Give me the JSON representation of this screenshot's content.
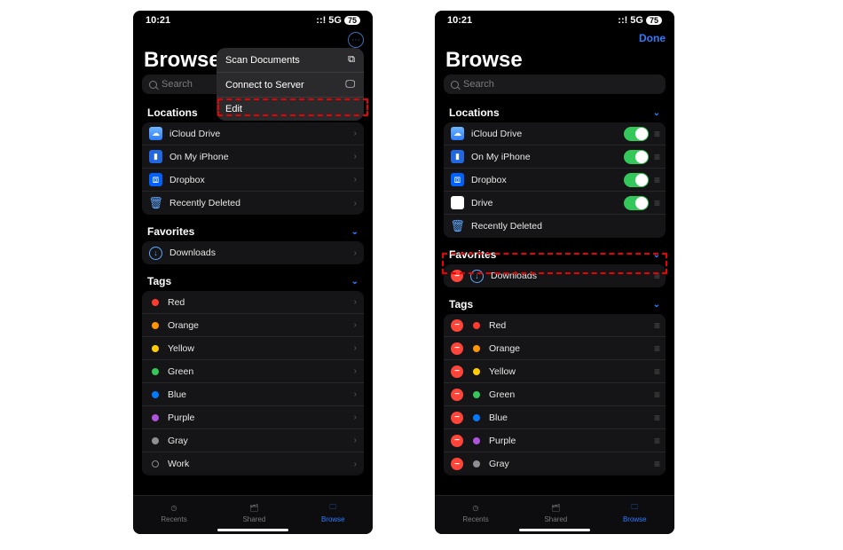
{
  "status": {
    "time": "10:21",
    "network": "5G",
    "battery": "75"
  },
  "left": {
    "title": "Browse",
    "search_placeholder": "Search",
    "popup": {
      "scan": "Scan Documents",
      "connect": "Connect to Server",
      "edit": "Edit"
    },
    "sections": {
      "locations": {
        "title": "Locations",
        "items": [
          {
            "label": "iCloud Drive"
          },
          {
            "label": "On My iPhone"
          },
          {
            "label": "Dropbox"
          },
          {
            "label": "Recently Deleted"
          }
        ]
      },
      "favorites": {
        "title": "Favorites",
        "items": [
          {
            "label": "Downloads"
          }
        ]
      },
      "tags": {
        "title": "Tags",
        "items": [
          {
            "label": "Red",
            "color": "#ff3b30"
          },
          {
            "label": "Orange",
            "color": "#ff9500"
          },
          {
            "label": "Yellow",
            "color": "#ffcc00"
          },
          {
            "label": "Green",
            "color": "#34c759"
          },
          {
            "label": "Blue",
            "color": "#007aff"
          },
          {
            "label": "Purple",
            "color": "#af52de"
          },
          {
            "label": "Gray",
            "color": "#8e8e93"
          },
          {
            "label": "Work",
            "color": ""
          }
        ]
      }
    }
  },
  "right": {
    "title": "Browse",
    "done": "Done",
    "search_placeholder": "Search",
    "sections": {
      "locations": {
        "title": "Locations",
        "items": [
          {
            "label": "iCloud Drive",
            "enabled": true
          },
          {
            "label": "On My iPhone",
            "enabled": true
          },
          {
            "label": "Dropbox",
            "enabled": true
          },
          {
            "label": "Drive",
            "enabled": true
          },
          {
            "label": "Recently Deleted"
          }
        ]
      },
      "favorites": {
        "title": "Favorites",
        "items": [
          {
            "label": "Downloads"
          }
        ]
      },
      "tags": {
        "title": "Tags",
        "items": [
          {
            "label": "Red",
            "color": "#ff3b30"
          },
          {
            "label": "Orange",
            "color": "#ff9500"
          },
          {
            "label": "Yellow",
            "color": "#ffcc00"
          },
          {
            "label": "Green",
            "color": "#34c759"
          },
          {
            "label": "Blue",
            "color": "#007aff"
          },
          {
            "label": "Purple",
            "color": "#af52de"
          },
          {
            "label": "Gray",
            "color": "#8e8e93"
          }
        ]
      }
    }
  },
  "tabs": {
    "recents": "Recents",
    "shared": "Shared",
    "browse": "Browse"
  }
}
